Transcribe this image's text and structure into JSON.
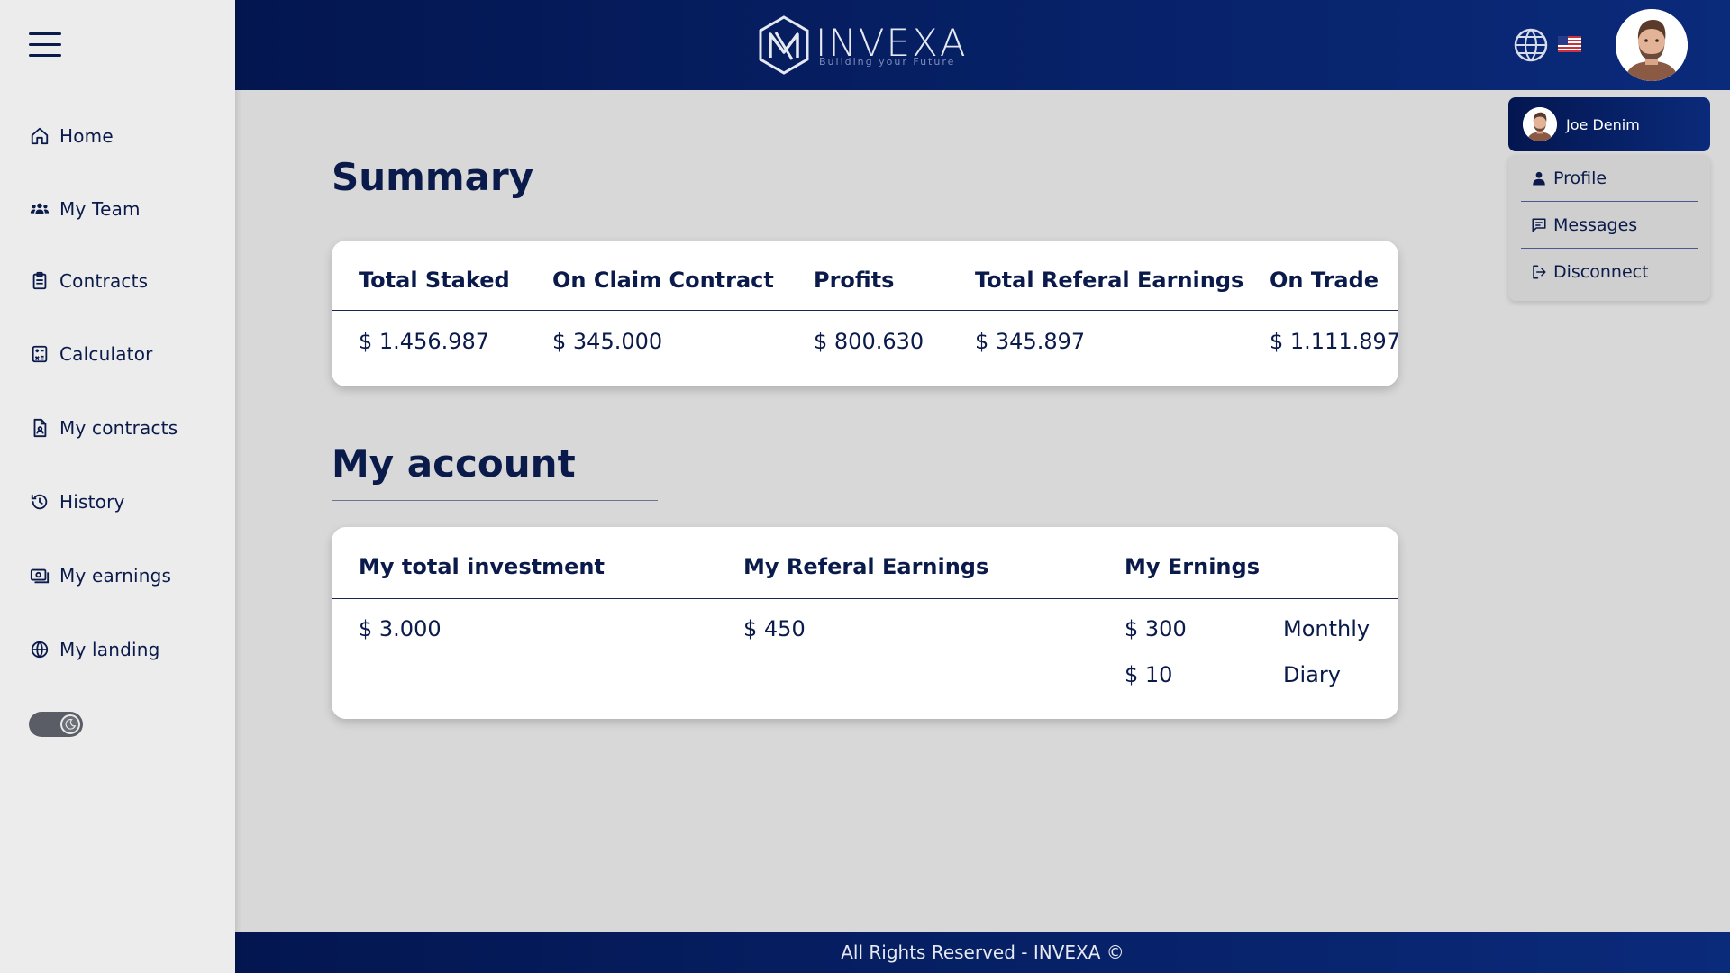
{
  "sidebar": {
    "items": [
      {
        "label": "Home",
        "icon": "home-icon"
      },
      {
        "label": "My Team",
        "icon": "team-icon"
      },
      {
        "label": "Contracts",
        "icon": "clipboard-icon"
      },
      {
        "label": "Calculator",
        "icon": "calculator-icon"
      },
      {
        "label": "My contracts",
        "icon": "document-icon"
      },
      {
        "label": "History",
        "icon": "history-icon"
      },
      {
        "label": "My earnings",
        "icon": "money-icon"
      },
      {
        "label": "My landing",
        "icon": "globe-icon"
      }
    ]
  },
  "header": {
    "logo_name": "INVEXA",
    "logo_tagline": "Building your Future"
  },
  "user": {
    "name": "Joe Denim",
    "menu": [
      {
        "label": "Profile",
        "icon": "person-icon"
      },
      {
        "label": "Messages",
        "icon": "message-icon"
      },
      {
        "label": "Disconnect",
        "icon": "logout-icon"
      }
    ]
  },
  "summary": {
    "title": "Summary",
    "columns": [
      "Total Staked",
      "On Claim Contract",
      "Profits",
      "Total Referal Earnings",
      "On Trade"
    ],
    "values": [
      "$ 1.456.987",
      "$ 345.000",
      "$ 800.630",
      "$ 345.897",
      "$ 1.111.897"
    ]
  },
  "account": {
    "title": "My account",
    "columns": [
      "My total investment",
      "My Referal Earnings",
      "My Ernings"
    ],
    "total_investment": "$ 3.000",
    "referal_earnings": "$ 450",
    "earnings": [
      {
        "amount": "$ 300",
        "period": "Monthly"
      },
      {
        "amount": "$ 10",
        "period": "Diary"
      }
    ]
  },
  "footer": {
    "text": "All Rights Reserved - INVEXA ©"
  },
  "colors": {
    "primary_dark": "#031650",
    "primary": "#0a2a7a",
    "text": "#0a1a4a",
    "background": "#d8d8d8",
    "sidebar": "#ececec"
  }
}
